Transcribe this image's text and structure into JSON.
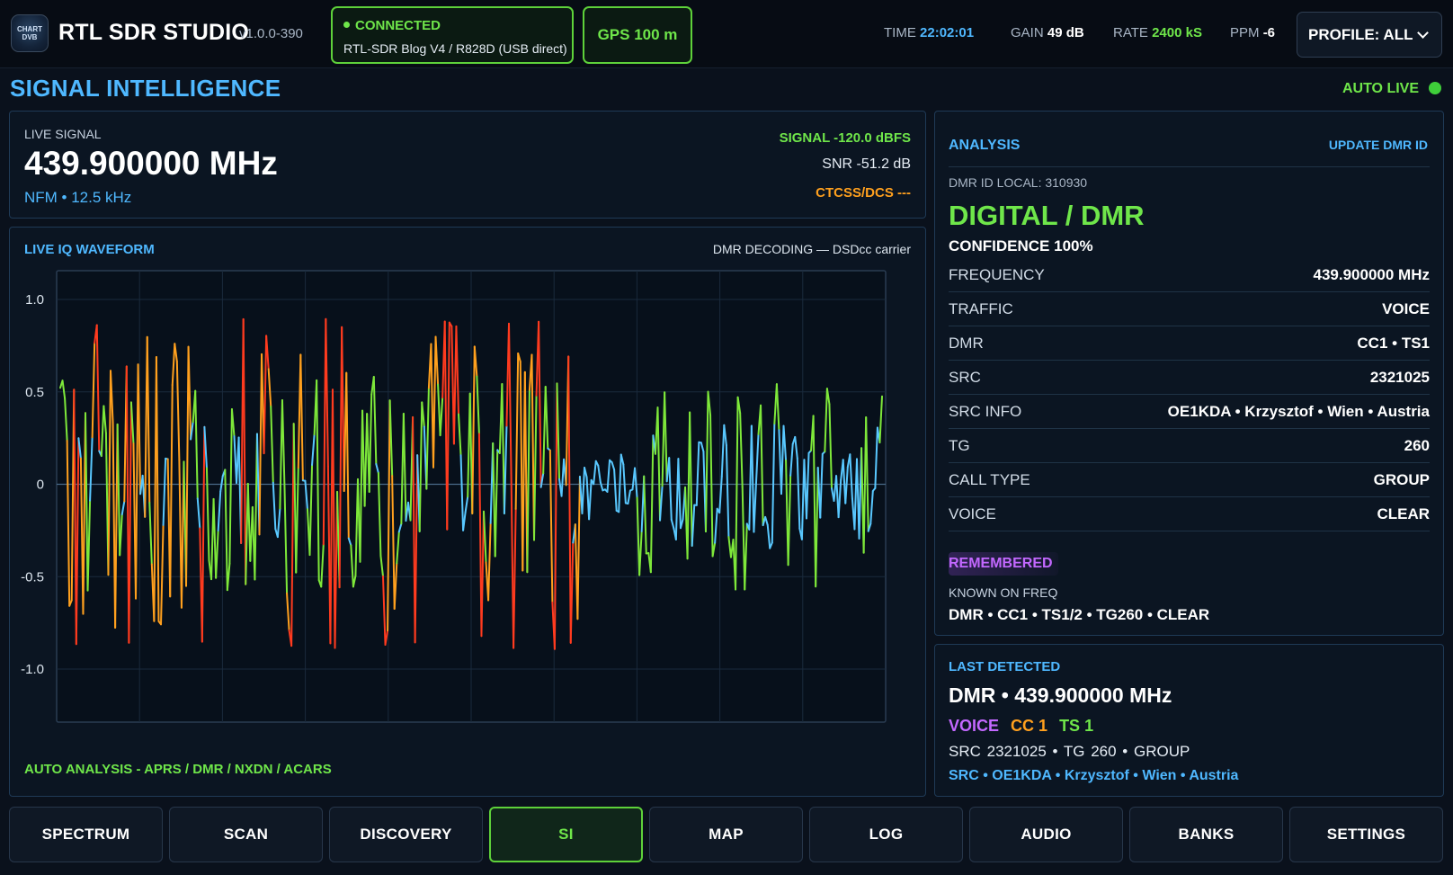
{
  "header": {
    "logo_text": "CHART DVB",
    "app_title": "RTL SDR STUDIO",
    "version": "v1.0.0-390",
    "connection": {
      "status": "CONNECTED",
      "device": "RTL-SDR Blog V4 / R828D (USB direct)"
    },
    "gps": "GPS 100 m",
    "time_label": "TIME",
    "time_value": "22:02:01",
    "gain_label": "GAIN",
    "gain_value": "49 dB",
    "rate_label": "RATE",
    "rate_value": "2400 kS",
    "ppm_label": "PPM",
    "ppm_value": "-6",
    "profile": "PROFILE: ALL"
  },
  "page": {
    "title": "SIGNAL INTELLIGENCE",
    "auto_live": "AUTO LIVE"
  },
  "live_signal": {
    "label": "LIVE SIGNAL",
    "frequency": "439.900000 MHz",
    "mode": "NFM  •  12.5 kHz",
    "signal": "SIGNAL  -120.0 dBFS",
    "snr": "SNR  -51.2 dB",
    "ctcss": "CTCSS/DCS ---"
  },
  "waveform": {
    "title": "LIVE IQ WAVEFORM",
    "status": "DMR DECODING — DSDcc carrier",
    "footer": "AUTO ANALYSIS - APRS / DMR / NXDN / ACARS",
    "y_ticks": [
      "1.0",
      "0.5",
      "0",
      "-0.5",
      "-1.0"
    ],
    "ylim": [
      -1.0,
      1.0
    ],
    "colors": {
      "low": "#59c8ff",
      "mid": "#7ee83a",
      "high": "#ffa01e",
      "peak": "#ff3b1f",
      "grid": "#1a2a3c"
    }
  },
  "analysis": {
    "title": "ANALYSIS",
    "update_button": "UPDATE DMR ID",
    "dmr_id_local": "DMR ID LOCAL: 310930",
    "type": "DIGITAL / DMR",
    "confidence": "CONFIDENCE 100%",
    "rows": [
      {
        "key": "FREQUENCY",
        "value": "439.900000 MHz"
      },
      {
        "key": "TRAFFIC",
        "value": "VOICE"
      },
      {
        "key": "DMR",
        "value": "CC1 • TS1"
      },
      {
        "key": "SRC",
        "value": "2321025"
      },
      {
        "key": "SRC INFO",
        "value": "OE1KDA  •  Krzysztof  •  Wien  •  Austria"
      },
      {
        "key": "TG",
        "value": "260"
      },
      {
        "key": "CALL TYPE",
        "value": "GROUP"
      },
      {
        "key": "VOICE",
        "value": "CLEAR"
      }
    ],
    "remembered": "REMEMBERED",
    "known_label": "KNOWN ON FREQ",
    "known_value": "DMR • CC1 • TS1/2 • TG260 • CLEAR"
  },
  "last_detected": {
    "title": "LAST DETECTED",
    "main": "DMR  •  439.900000 MHz",
    "voice": "VOICE",
    "cc": "CC 1",
    "ts": "TS 1",
    "src_line": "SRC 2321025    •    TG 260    •    GROUP",
    "info": "SRC • OE1KDA • Krzysztof • Wien • Austria"
  },
  "tabs": [
    {
      "label": "SPECTRUM",
      "active": false
    },
    {
      "label": "SCAN",
      "active": false
    },
    {
      "label": "DISCOVERY",
      "active": false
    },
    {
      "label": "SI",
      "active": true
    },
    {
      "label": "MAP",
      "active": false
    },
    {
      "label": "LOG",
      "active": false
    },
    {
      "label": "AUDIO",
      "active": false
    },
    {
      "label": "BANKS",
      "active": false
    },
    {
      "label": "SETTINGS",
      "active": false
    }
  ]
}
